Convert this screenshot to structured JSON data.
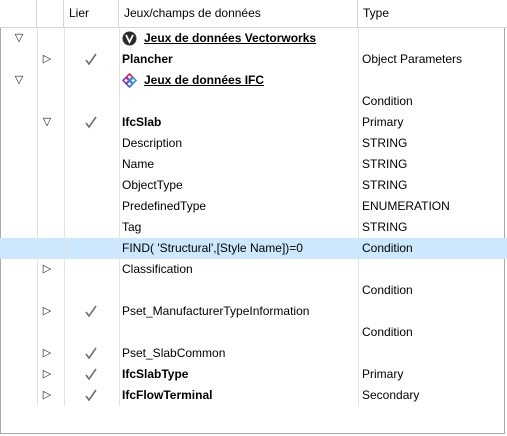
{
  "header": {
    "col_link": "Lier",
    "col_name": "Jeux/champs de données",
    "col_type": "Type"
  },
  "rows": [
    {
      "expander": "▽",
      "name": "Jeux de données Vectorworks",
      "type": "",
      "bold": true,
      "underline": true,
      "icon": "vectorworks-icon",
      "check": false,
      "indent": 0
    },
    {
      "expander": "▷",
      "name": "Plancher",
      "type": "Object Parameters",
      "bold": true,
      "check": true,
      "indent": 1
    },
    {
      "expander": "▽",
      "name": "Jeux de données IFC",
      "type": "",
      "bold": true,
      "underline": true,
      "icon": "ifc-icon",
      "check": false,
      "indent": 0
    },
    {
      "expander": "",
      "name": "",
      "type": "Condition",
      "check": false,
      "indent": 1
    },
    {
      "expander": "▽",
      "name": "IfcSlab",
      "type": "Primary",
      "bold": true,
      "check": true,
      "indent": 2
    },
    {
      "expander": "",
      "name": "Description",
      "type": "STRING",
      "check": false,
      "indent": 3
    },
    {
      "expander": "",
      "name": "Name",
      "type": "STRING",
      "check": false,
      "indent": 3
    },
    {
      "expander": "",
      "name": "ObjectType",
      "type": "STRING",
      "check": false,
      "indent": 3
    },
    {
      "expander": "",
      "name": "PredefinedType",
      "type": "ENUMERATION",
      "check": false,
      "indent": 3
    },
    {
      "expander": "",
      "name": "Tag",
      "type": "STRING",
      "check": false,
      "indent": 3
    },
    {
      "expander": "",
      "name": "FIND( 'Structural',[Style Name])=0",
      "type": "Condition",
      "check": false,
      "indent": 3,
      "selected": true
    },
    {
      "expander": "▷",
      "name": "Classification",
      "type": "",
      "check": false,
      "indent": 2
    },
    {
      "expander": "",
      "name": "",
      "type": "Condition",
      "check": false,
      "indent": 3
    },
    {
      "expander": "▷",
      "name": "Pset_ManufacturerTypeInformation",
      "type": "",
      "check": true,
      "indent": 2
    },
    {
      "expander": "",
      "name": "",
      "type": "Condition",
      "check": false,
      "indent": 3
    },
    {
      "expander": "▷",
      "name": "Pset_SlabCommon",
      "type": "",
      "check": true,
      "indent": 2
    },
    {
      "expander": "▷",
      "name": "IfcSlabType",
      "type": "Primary",
      "bold": true,
      "check": true,
      "indent": 2
    },
    {
      "expander": "▷",
      "name": "IfcFlowTerminal",
      "type": "Secondary",
      "bold": true,
      "check": true,
      "indent": 2
    }
  ],
  "colors": {
    "selection": "#cce8ff",
    "grid": "#e3e3e3",
    "border": "#a9a9a9"
  }
}
